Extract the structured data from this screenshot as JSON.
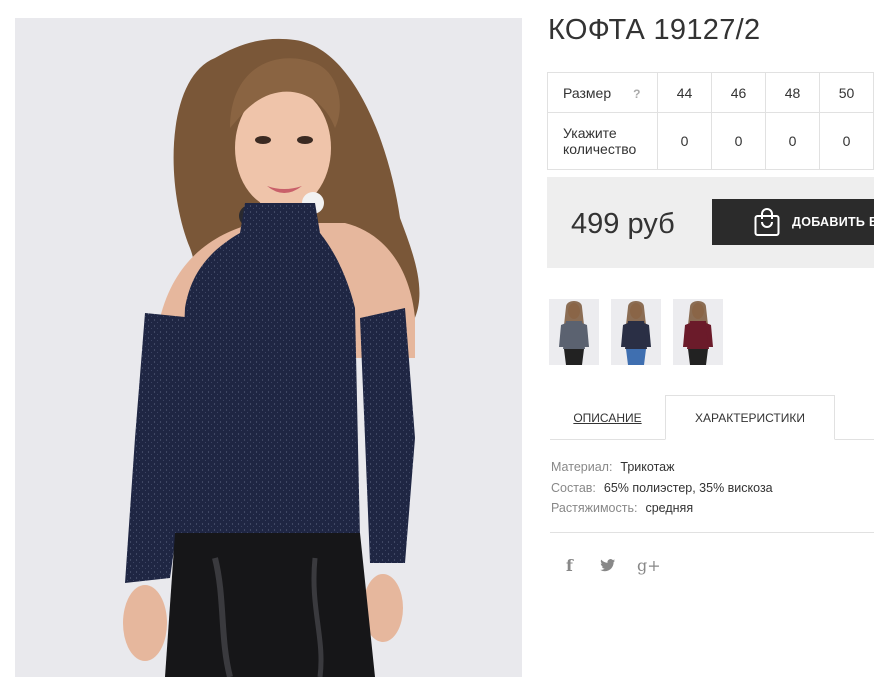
{
  "product": {
    "title": "КОФТА 19127/2",
    "price": "499 руб",
    "add_to_cart_label": "ДОБАВИТЬ В"
  },
  "size_table": {
    "size_label": "Размер",
    "help_label": "?",
    "quantity_label": "Укажите количество",
    "sizes": [
      "44",
      "46",
      "48",
      "50"
    ],
    "quantities": [
      "0",
      "0",
      "0",
      "0"
    ]
  },
  "thumbnails": [
    {
      "icon": "thumbnail-grey-top"
    },
    {
      "icon": "thumbnail-navy-top"
    },
    {
      "icon": "thumbnail-burgundy-top"
    }
  ],
  "tabs": {
    "description": "ОПИСАНИЕ",
    "characteristics": "ХАРАКТЕРИСТИКИ",
    "active": "characteristics"
  },
  "specs": [
    {
      "key": "Материал:",
      "value": "Трикотаж"
    },
    {
      "key": "Состав:",
      "value": "65% полиэстер, 35% вискоза"
    },
    {
      "key": "Растяжимость:",
      "value": "средняя"
    }
  ],
  "social": {
    "facebook": "f",
    "twitter": "twitter-icon",
    "googleplus": "g+"
  },
  "colors": {
    "button_bg": "#2b2b2b",
    "price_box_bg": "#eeeeee",
    "top_navy": "#1f2643",
    "top_burgundy": "#6b1b2a"
  }
}
